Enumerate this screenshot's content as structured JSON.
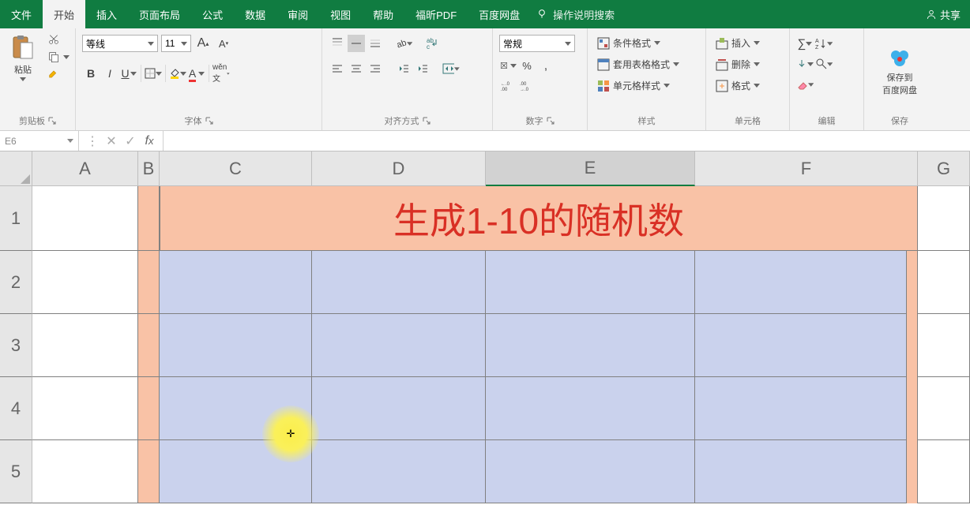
{
  "menu": {
    "items": [
      "文件",
      "开始",
      "插入",
      "页面布局",
      "公式",
      "数据",
      "审阅",
      "视图",
      "帮助",
      "福昕PDF",
      "百度网盘"
    ],
    "active_index": 1,
    "search": "操作说明搜索",
    "share": "共享"
  },
  "ribbon": {
    "clipboard": {
      "label": "剪贴板",
      "paste": "粘贴"
    },
    "font": {
      "label": "字体",
      "name": "等线",
      "size": "11",
      "grow": "A",
      "shrink": "A"
    },
    "align": {
      "label": "对齐方式",
      "wrap": "ab"
    },
    "number": {
      "label": "数字",
      "format": "常规"
    },
    "styles": {
      "label": "样式",
      "conditional": "条件格式",
      "table": "套用表格格式",
      "cell": "单元格样式"
    },
    "cells": {
      "label": "单元格",
      "insert": "插入",
      "delete": "删除",
      "format": "格式"
    },
    "editing": {
      "label": "编辑"
    },
    "baidu": {
      "label": "保存",
      "button": "保存到\n百度网盘"
    }
  },
  "formula_bar": {
    "name_box": "E6",
    "formula": ""
  },
  "sheet": {
    "col_headers": [
      "A",
      "B",
      "C",
      "D",
      "E",
      "F",
      "G"
    ],
    "row_headers": [
      "1",
      "2",
      "3",
      "4",
      "5"
    ],
    "title": "生成1-10的随机数",
    "active_col": "E"
  }
}
